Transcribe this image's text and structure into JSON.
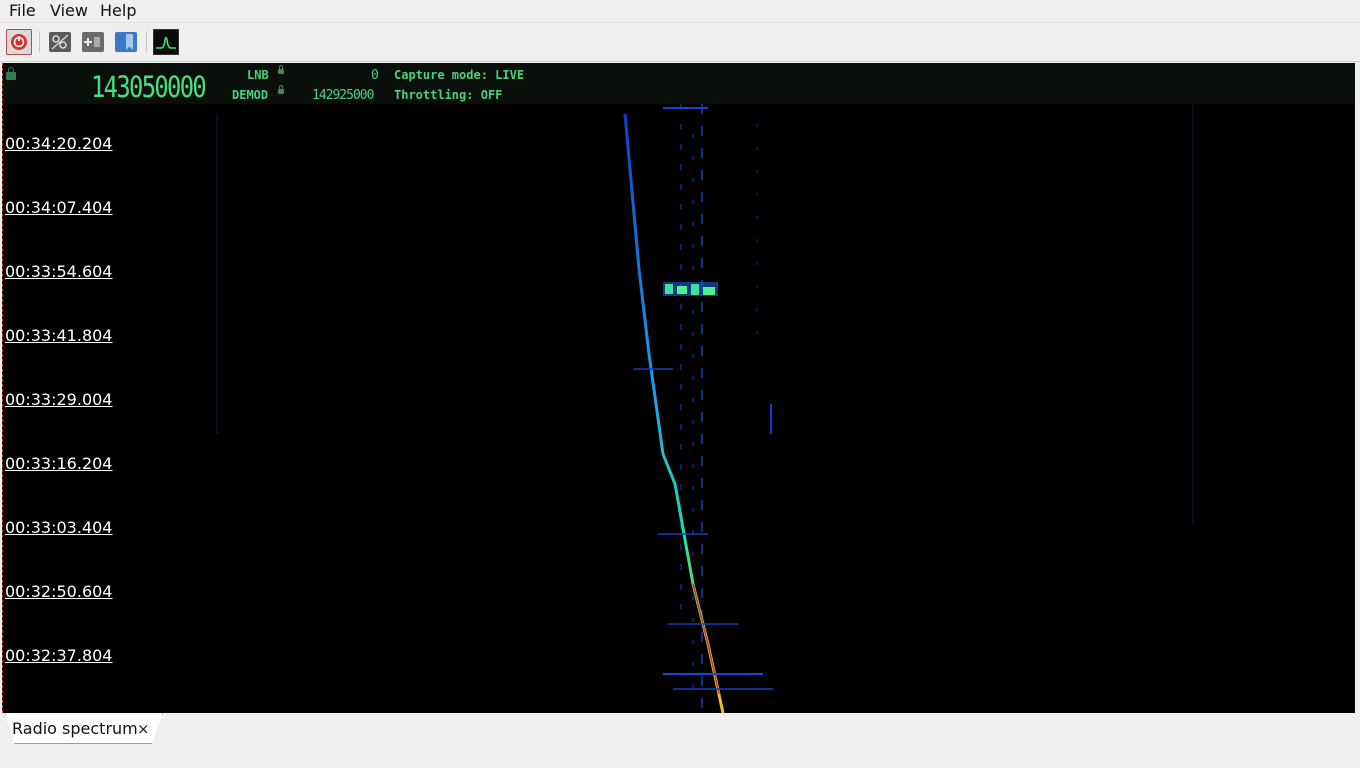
{
  "menubar": {
    "items": [
      {
        "label": "File"
      },
      {
        "label": "View"
      },
      {
        "label": "Help"
      }
    ]
  },
  "toolbar": {
    "buttons": [
      {
        "icon": "power-icon",
        "active": true
      },
      {
        "icon": "settings-icon"
      },
      {
        "icon": "add-inspector-icon"
      },
      {
        "icon": "bookmark-icon"
      },
      {
        "icon": "spectrum-panel-icon"
      }
    ]
  },
  "hud": {
    "main_frequency": "143050000",
    "lnb_label": "LNB",
    "lnb_value": "0",
    "demod_label": "DEMOD",
    "demod_value": "142925000",
    "capture_mode": "Capture mode: LIVE",
    "throttling": "Throttling: OFF"
  },
  "waterfall": {
    "timestamps": [
      "00:34:20.204",
      "00:34:07.404",
      "00:33:54.604",
      "00:33:41.804",
      "00:33:29.004",
      "00:33:16.204",
      "00:33:03.404",
      "00:32:50.604",
      "00:32:37.804"
    ]
  },
  "tabs": [
    {
      "label": "Radio spectrum",
      "close": "×"
    }
  ],
  "colors": {
    "hud_green": "#49d27d",
    "waterfall_bg": "#000000",
    "accent_red": "#cc2222"
  }
}
